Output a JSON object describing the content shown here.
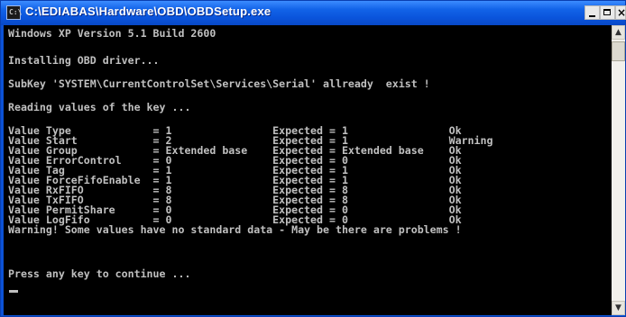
{
  "window": {
    "title": "C:\\EDIABAS\\Hardware\\OBD\\OBDSetup.exe",
    "icon": "console-window-icon",
    "icon_glyph": "C:\\"
  },
  "titlebar_buttons": {
    "minimize": "minimize-icon",
    "maximize": "maximize-icon",
    "close_glyph": "×"
  },
  "console": {
    "lines": [
      "Windows XP Version 5.1 Build 2600",
      "Installing OBD driver...",
      "SubKey 'SYSTEM\\CurrentControlSet\\Services\\Serial' allready  exist !",
      "Reading values of the key ...",
      "Value Type             = 1                Expected = 1                Ok",
      "Value Start            = 2                Expected = 1                Warning",
      "Value Group            = Extended base    Expected = Extended base    Ok",
      "Value ErrorControl     = 0                Expected = 0                Ok",
      "Value Tag              = 1                Expected = 1                Ok",
      "Value ForceFifoEnable  = 1                Expected = 1                Ok",
      "Value RxFIFO           = 8                Expected = 8                Ok",
      "Value TxFIFO           = 8                Expected = 8                Ok",
      "Value PermitShare      = 0                Expected = 0                Ok",
      "Value LogFifo          = 0                Expected = 0                Ok",
      "Warning! Some values have no standard data - May be there are problems !",
      "Press any key to continue ..."
    ]
  },
  "scrollbar": {
    "up_glyph": "▲",
    "down_glyph": "▼"
  },
  "colors": {
    "console_background": "#000000",
    "console_text": "#c0c0c0",
    "titlebar": "#0a54db"
  }
}
